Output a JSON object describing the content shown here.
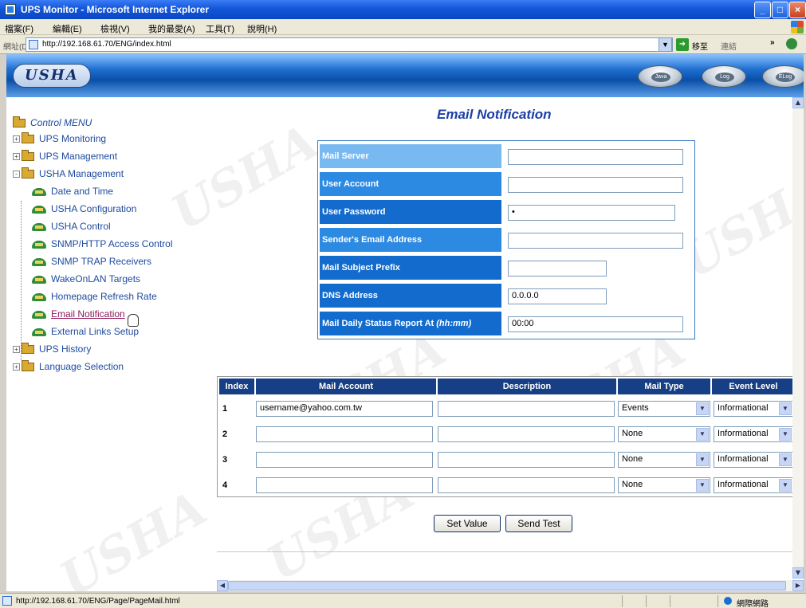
{
  "window": {
    "title": "UPS Monitor - Microsoft Internet Explorer",
    "min": "_",
    "max": "□",
    "close": "×"
  },
  "menubar": {
    "items": [
      "檔案(F)",
      "編輯(E)",
      "檢視(V)",
      "我的最愛(A)",
      "工具(T)",
      "說明(H)"
    ]
  },
  "addressbar": {
    "label": "網址(D)",
    "url": "http://192.168.61.70/ENG/index.html",
    "go_label": "移至",
    "links_label": "連結",
    "more": "»"
  },
  "banner": {
    "logo": "USHA",
    "buttons": [
      "Java",
      "Log",
      "ELog"
    ]
  },
  "sidebar": {
    "root": "Control MENU",
    "groups": [
      {
        "label": "UPS Monitoring",
        "expander": "+"
      },
      {
        "label": "UPS Management",
        "expander": "+"
      },
      {
        "label": "USHA Management",
        "expander": "-"
      }
    ],
    "usha_items": [
      "Date and Time",
      "USHA Configuration",
      "USHA Control",
      "SNMP/HTTP Access Control",
      "SNMP TRAP Receivers",
      "WakeOnLAN Targets",
      "Homepage Refresh Rate",
      "Email Notification",
      "External Links Setup"
    ],
    "tail_groups": [
      {
        "label": "UPS History",
        "expander": "+"
      },
      {
        "label": "Language Selection",
        "expander": "+"
      }
    ]
  },
  "page": {
    "title": "Email Notification"
  },
  "form": {
    "mail_server": {
      "label": "Mail Server",
      "value": ""
    },
    "user_account": {
      "label": "User Account",
      "value": ""
    },
    "user_password": {
      "label": "User Password",
      "value": "•"
    },
    "sender_email": {
      "label": "Sender's Email Address",
      "value": ""
    },
    "subject_prefix": {
      "label": "Mail Subject Prefix",
      "value": ""
    },
    "dns_address": {
      "label": "DNS Address",
      "value": "0.0.0.0"
    },
    "daily_report": {
      "label": "Mail Daily Status Report At",
      "label_suffix": "(hh:mm)",
      "value": "00:00"
    }
  },
  "colors": {
    "row_light": "#78b9f2",
    "row_mid": "#2d8ae2",
    "row_dark": "#136ccd",
    "header_dark": "#173f85"
  },
  "accounts": {
    "headers": {
      "index": "Index",
      "mail_account": "Mail Account",
      "description": "Description",
      "mail_type": "Mail Type",
      "event_level": "Event Level"
    },
    "rows": [
      {
        "index": "1",
        "mail_account": "username@yahoo.com.tw",
        "description": "",
        "mail_type": "Events",
        "event_level": "Informational"
      },
      {
        "index": "2",
        "mail_account": "",
        "description": "",
        "mail_type": "None",
        "event_level": "Informational"
      },
      {
        "index": "3",
        "mail_account": "",
        "description": "",
        "mail_type": "None",
        "event_level": "Informational"
      },
      {
        "index": "4",
        "mail_account": "",
        "description": "",
        "mail_type": "None",
        "event_level": "Informational"
      }
    ]
  },
  "actions": {
    "set_value": "Set Value",
    "send_test": "Send Test"
  },
  "statusbar": {
    "text": "http://192.168.61.70/ENG/Page/PageMail.html",
    "zone": "網際網路"
  },
  "watermark": "USHA"
}
